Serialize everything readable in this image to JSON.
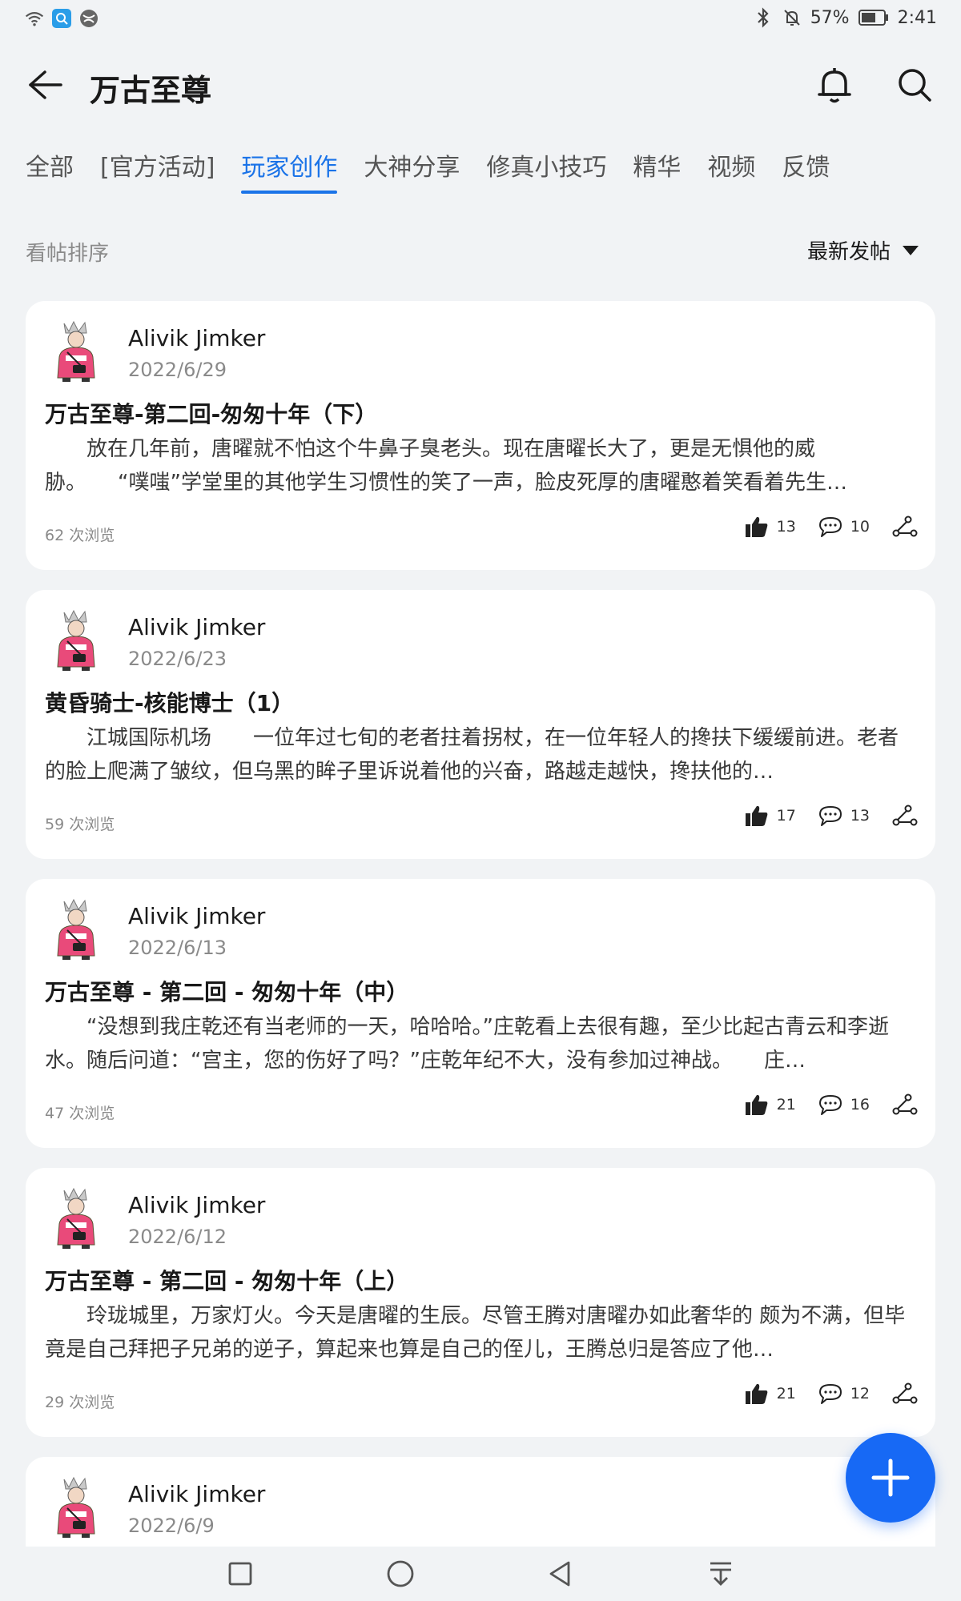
{
  "status_bar": {
    "battery": "57%",
    "time": "2:41",
    "icons": [
      "wifi-icon",
      "app-icon",
      "browser-icon",
      "bluetooth-icon",
      "mute-icon",
      "battery-icon"
    ]
  },
  "header": {
    "title": "万古至尊",
    "back_icon": "back-arrow-icon",
    "bell_icon": "bell-icon",
    "search_icon": "search-icon"
  },
  "tabs": [
    {
      "label": "全部",
      "active": false
    },
    {
      "label": "[官方活动]",
      "active": false
    },
    {
      "label": "玩家创作",
      "active": true
    },
    {
      "label": "大神分享",
      "active": false
    },
    {
      "label": "修真小技巧",
      "active": false
    },
    {
      "label": "精华",
      "active": false
    },
    {
      "label": "视频",
      "active": false
    },
    {
      "label": "反馈",
      "active": false
    }
  ],
  "sort": {
    "label": "看帖排序",
    "selected": "最新发帖"
  },
  "posts": [
    {
      "author": "Alivik Jimker",
      "date": "2022/6/29",
      "title": "万古至尊-第二回-匆匆十年（下）",
      "excerpt": "　　放在几年前，唐曜就不怕这个牛鼻子臭老头。现在唐曜长大了，更是无惧他的威胁。　　“噗嗤”学堂里的其他学生习惯性的笑了一声，脸皮死厚的唐曜憨着笑看着先生…",
      "views": "62 次浏览",
      "likes": "13",
      "comments": "10"
    },
    {
      "author": "Alivik Jimker",
      "date": "2022/6/23",
      "title": "黄昏骑士-核能博士（1）",
      "excerpt": "　　江城国际机场　　一位年过七旬的老者拄着拐杖，在一位年轻人的搀扶下缓缓前进。老者的脸上爬满了皱纹，但乌黑的眸子里诉说着他的兴奋，路越走越快，搀扶他的…",
      "views": "59 次浏览",
      "likes": "17",
      "comments": "13"
    },
    {
      "author": "Alivik Jimker",
      "date": "2022/6/13",
      "title": "万古至尊 - 第二回 - 匆匆十年（中）",
      "excerpt": "　　“没想到我庄乾还有当老师的一天，哈哈哈。”庄乾看上去很有趣，至少比起古青云和李逝水。随后问道：“宫主，您的伤好了吗？”庄乾年纪不大，没有参加过神战。　　庄…",
      "views": "47 次浏览",
      "likes": "21",
      "comments": "16"
    },
    {
      "author": "Alivik Jimker",
      "date": "2022/6/12",
      "title": "万古至尊 - 第二回 - 匆匆十年（上）",
      "excerpt": "　　玲珑城里，万家灯火。今天是唐曜的生辰。尽管王腾对唐曜办如此奢华的 颇为不满，但毕竟是自己拜把子兄弟的逆子，算起来也算是自己的侄儿，王腾总归是答应了他…",
      "views": "29 次浏览",
      "likes": "21",
      "comments": "12"
    },
    {
      "author": "Alivik Jimker",
      "date": "2022/6/9"
    }
  ],
  "fab": {
    "icon": "plus-icon"
  },
  "nav": {
    "icons": [
      "recents-square-icon",
      "home-circle-icon",
      "back-triangle-icon",
      "notification-pull-icon"
    ]
  },
  "colors": {
    "accent": "#1a73e8",
    "fab": "#1769f5",
    "background": "#f1f3f5"
  }
}
